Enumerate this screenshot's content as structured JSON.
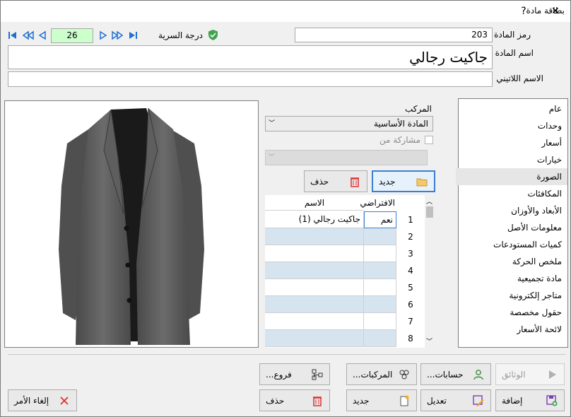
{
  "window": {
    "title": "بطاقة مادة",
    "help_glyph": "?",
    "close_glyph": "✕"
  },
  "nav": {
    "record_number": "26"
  },
  "security": {
    "label": "درجة السرية",
    "icon": "shield-check-icon",
    "color": "#3fa34d"
  },
  "fields": {
    "code_label": "رمز المادة",
    "code_value": "203",
    "name_label": "اسم المادة",
    "name_value": "جاكيت رجالي",
    "latin_label": "الاسم اللاتيني",
    "latin_value": ""
  },
  "composite": {
    "label": "المركب",
    "selected": "المادة الأساسية",
    "share_label": "مشاركة من",
    "share_select": ""
  },
  "image_actions": {
    "new_label": "جديد",
    "delete_label": "حذف"
  },
  "grid": {
    "col_default": "الافتراضي",
    "col_name": "الاسم",
    "row_numbers": [
      "1",
      "2",
      "3",
      "4",
      "5",
      "6",
      "7",
      "8"
    ],
    "rows": [
      {
        "default": "نعم",
        "name": "جاكيت رجالي (1)"
      }
    ]
  },
  "sidebar": {
    "items": [
      {
        "label": "عام"
      },
      {
        "label": "وحدات"
      },
      {
        "label": "أسعار"
      },
      {
        "label": "خيارات"
      },
      {
        "label": "الصورة",
        "selected": true
      },
      {
        "label": "المكافئات"
      },
      {
        "label": "الأبعاد والأوزان"
      },
      {
        "label": "معلومات الأصل"
      },
      {
        "label": "كميات المستودعات"
      },
      {
        "label": "ملخص الحركة"
      },
      {
        "label": "مادة تجميعية"
      },
      {
        "label": "متاجر إلكترونية"
      },
      {
        "label": "حقول مخصصة"
      },
      {
        "label": "لائحة الأسعار"
      }
    ]
  },
  "bottom": {
    "documents": "الوثائق",
    "accounts": "حسابات...",
    "composites": "المركبات...",
    "branches": "فروع...",
    "add": "إضافة",
    "edit": "تعديل",
    "new": "جديد",
    "delete": "حذف",
    "cancel": "إلغاء الأمر"
  },
  "colors": {
    "accent": "#3c7fd0",
    "grid_alt": "#d6e4f0",
    "record_bg": "#ccffcc",
    "nav_blue": "#1f6fd1"
  }
}
